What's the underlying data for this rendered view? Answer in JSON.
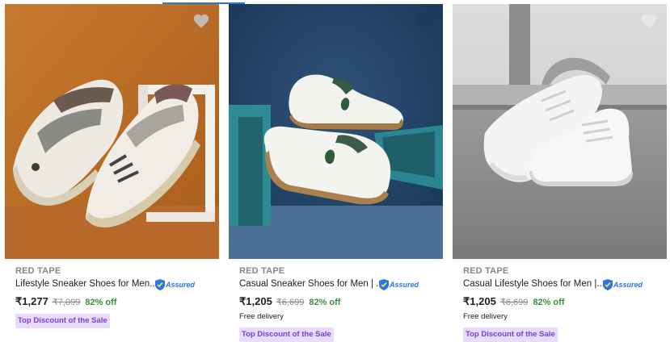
{
  "products": [
    {
      "brand": "RED TAPE",
      "title": "Lifestyle Sneaker Shoes for Men...",
      "assured_label": "Assured",
      "price": "₹1,277",
      "mrp": "₹7,099",
      "discount": "82% off",
      "delivery": "",
      "tag": "Top Discount of the Sale",
      "image_desc": "brown-grey retro sneakers on orange background",
      "wishlist_icon": "heart-icon"
    },
    {
      "brand": "RED TAPE",
      "title": "Casual Sneaker Shoes for Men | ...",
      "assured_label": "Assured",
      "price": "₹1,205",
      "mrp": "₹6,699",
      "discount": "82% off",
      "delivery": "Free delivery",
      "tag": "Top Discount of the Sale",
      "image_desc": "white sneakers on teal blocks, blue background",
      "wishlist_icon": "heart-icon"
    },
    {
      "brand": "RED TAPE",
      "title": "Casual Lifestyle Shoes for Men |...",
      "assured_label": "Assured",
      "price": "₹1,205",
      "mrp": "₹6,699",
      "discount": "82% off",
      "delivery": "Free delivery",
      "tag": "Top Discount of the Sale",
      "image_desc": "white high-top sneakers on road",
      "wishlist_icon": "heart-icon"
    }
  ],
  "colors": {
    "accent": "#2874f0",
    "discount": "#388e3c",
    "tag_bg": "#e7dcfb",
    "tag_text": "#7b3ed6"
  }
}
